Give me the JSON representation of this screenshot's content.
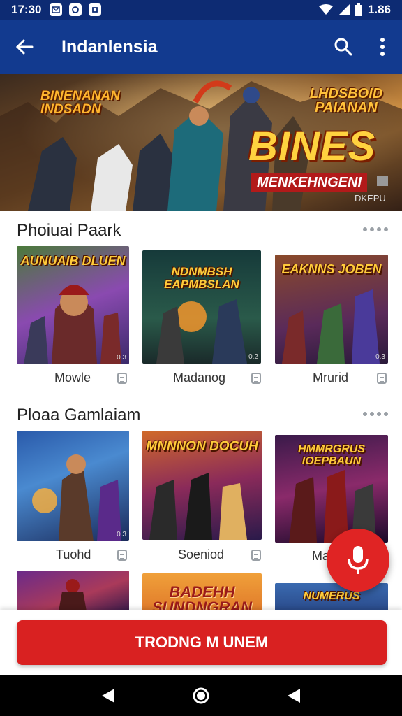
{
  "status_bar": {
    "time": "17:30",
    "battery": "1.86"
  },
  "app_bar": {
    "title": "Indanlensia",
    "back_icon": "arrow-left-icon",
    "search_icon": "search-icon",
    "menu_icon": "more-vert-icon"
  },
  "banner": {
    "left_title": "BINENANAN INDSADN",
    "right_title": "LHDSBOID PAIANAN",
    "main_title": "BINES",
    "subtitle": "MENKEHNGENI",
    "tag": "DKEPU"
  },
  "sections": [
    {
      "title": "Phoiuai Paark",
      "items": [
        {
          "caption": "Mowle",
          "thumb_title": "AUNUAIB DLUEN",
          "badge": "0.3"
        },
        {
          "caption": "Madanog",
          "thumb_title": "NDNMBSH EAPMBSLAN",
          "badge": "0.2"
        },
        {
          "caption": "Mrurid",
          "thumb_title": "EAKNNS JOBEN",
          "badge": "0.3"
        }
      ]
    },
    {
      "title": "Ploaa Gamlaiam",
      "items": [
        {
          "caption": "Tuohd",
          "thumb_title": "",
          "badge": "0.3"
        },
        {
          "caption": "Soeniod",
          "thumb_title": "MNNNON DOCUH",
          "badge": ""
        },
        {
          "caption": "Ma",
          "thumb_title": "HMMRGRUS IOEPBAUN",
          "badge": ""
        }
      ]
    },
    {
      "title": "",
      "items": [
        {
          "caption": "",
          "thumb_title": ""
        },
        {
          "caption": "",
          "thumb_title": "BADEHH SUNDNGRAN"
        },
        {
          "caption": "",
          "thumb_title": "NUMERUS"
        }
      ]
    }
  ],
  "fab": {
    "icon": "microphone-icon"
  },
  "main_button": {
    "label": "TRODNG M UNEM"
  },
  "nav_bar": {
    "back_icon": "triangle-back-icon",
    "home_icon": "circle-home-icon",
    "recents_icon": "triangle-recents-icon"
  },
  "colors": {
    "app_bar": "#123a8f",
    "status_bar": "#0d2b73",
    "accent_red": "#d92121"
  }
}
